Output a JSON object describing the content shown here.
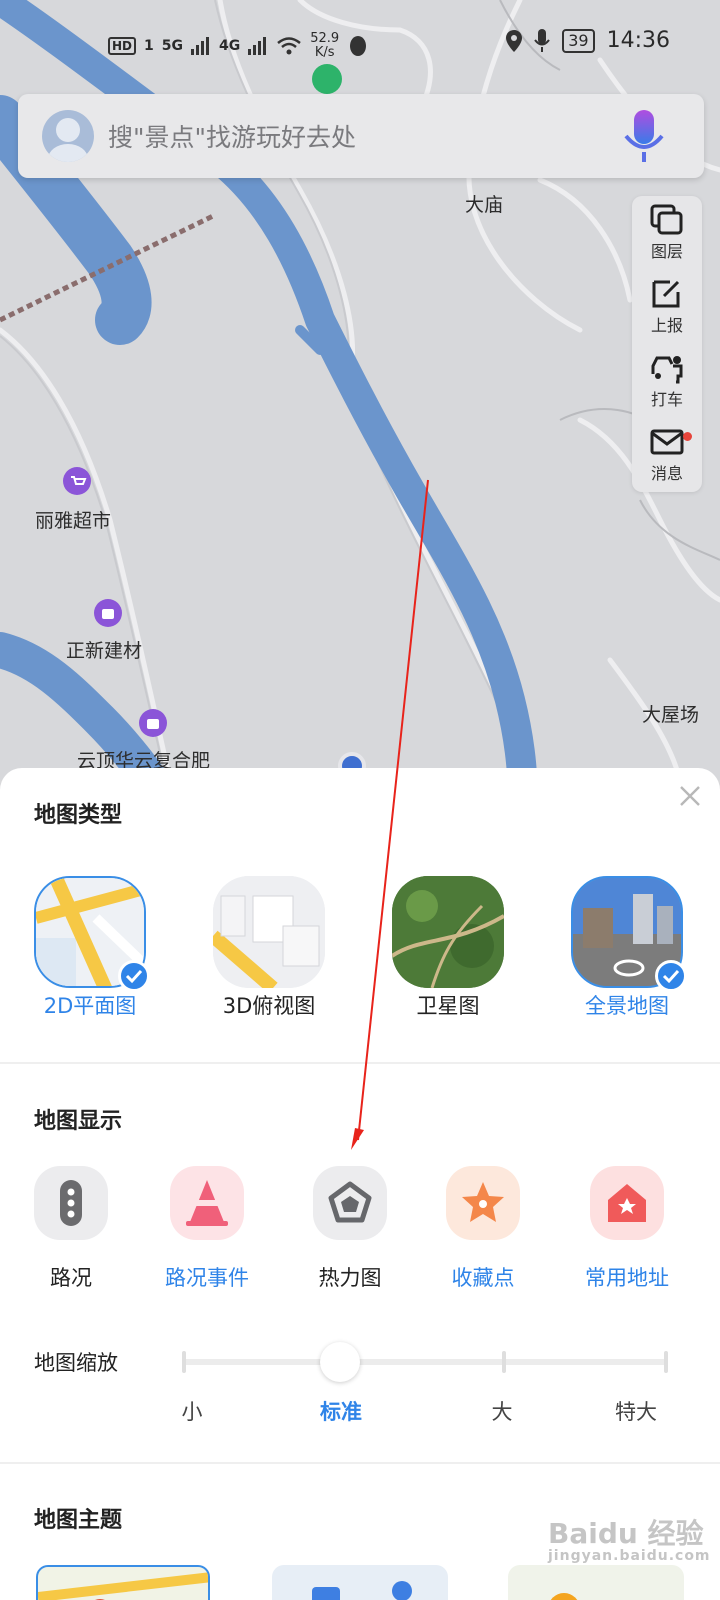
{
  "status_bar": {
    "hd": "HD",
    "sim": "1",
    "net1": "5G",
    "net2": "4G",
    "speed_value": "52.9",
    "speed_unit": "K/s",
    "battery": "39",
    "time": "14:36"
  },
  "search": {
    "placeholder": "搜\"景点\"找游玩好去处"
  },
  "toolbar": {
    "layers_label": "图层",
    "report_label": "上报",
    "taxi_label": "打车",
    "message_label": "消息"
  },
  "map_labels": {
    "damiao": "大庙",
    "liya": "丽雅超市",
    "zhengxin": "正新建材",
    "yunding": "云顶华云复合肥",
    "dawuchang": "大屋场"
  },
  "sheet": {
    "map_type_title": "地图类型",
    "map_types": [
      {
        "label": "2D平面图",
        "selected": true
      },
      {
        "label": "3D俯视图",
        "selected": false
      },
      {
        "label": "卫星图",
        "selected": false
      },
      {
        "label": "全景地图",
        "selected": true
      }
    ],
    "map_display_title": "地图显示",
    "display_items": [
      {
        "label": "路况",
        "icon": "traffic-light-icon"
      },
      {
        "label": "路况事件",
        "icon": "traffic-cone-icon"
      },
      {
        "label": "热力图",
        "icon": "heatmap-pentagon-icon"
      },
      {
        "label": "收藏点",
        "icon": "star-icon"
      },
      {
        "label": "常用地址",
        "icon": "home-icon"
      }
    ],
    "zoom_title": "地图缩放",
    "zoom_options": [
      "小",
      "标准",
      "大",
      "特大"
    ],
    "zoom_selected": "标准",
    "theme_title": "地图主题"
  },
  "watermark": {
    "text": "Baidu 经验",
    "sub": "jingyan.baidu.com"
  },
  "colors": {
    "accent": "#2f84e8",
    "river": "#6b95cc",
    "map_bg": "#d7d8db",
    "arrow": "#e8231b"
  }
}
